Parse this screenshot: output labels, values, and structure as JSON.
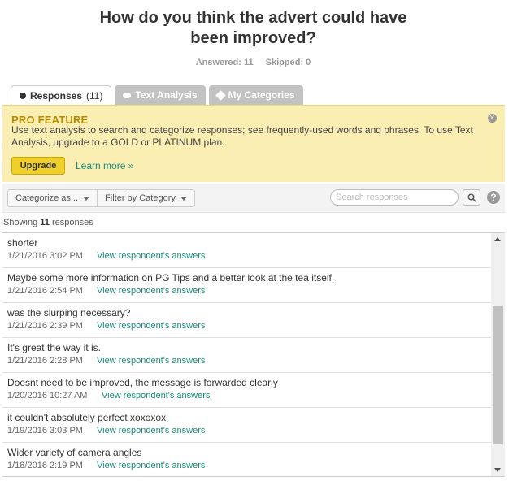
{
  "question": {
    "title_line1": "How do you think the advert could have",
    "title_line2": "been improved?",
    "answered": "Answered: 11",
    "skipped": "Skipped: 0"
  },
  "tabs": [
    {
      "label": "Responses",
      "count": "(11)",
      "icon": "dot-icon",
      "active": true
    },
    {
      "label": "Text Analysis",
      "icon": "cloud-icon",
      "active": false
    },
    {
      "label": "My Categories",
      "icon": "tag-icon",
      "active": false
    }
  ],
  "pro_banner": {
    "title": "PRO FEATURE",
    "text": "Use text analysis to search and categorize responses; see frequently-used words and phrases. To use Text Analysis, upgrade to a GOLD or PLATINUM plan.",
    "upgrade_label": "Upgrade",
    "learn_more_label": "Learn more »",
    "close_icon": "close-icon",
    "background": "#fbeeb2"
  },
  "filter_bar": {
    "categorize_label": "Categorize as...",
    "filter_label": "Filter by Category",
    "search_placeholder": "Search responses",
    "help_glyph": "?"
  },
  "showing": {
    "prefix": "Showing",
    "count": "11",
    "suffix": "responses"
  },
  "responses": [
    {
      "text": "shorter",
      "date": "1/21/2016 3:02 PM",
      "link": "View respondent's answers"
    },
    {
      "text": "Maybe some more information on PG Tips and a better look at the tea itself.",
      "date": "1/21/2016 2:54 PM",
      "link": "View respondent's answers"
    },
    {
      "text": "was the slurping necessary?",
      "date": "1/21/2016 2:39 PM",
      "link": "View respondent's answers"
    },
    {
      "text": "It's great the way it is.",
      "date": "1/21/2016 2:28 PM",
      "link": "View respondent's answers"
    },
    {
      "text": "Doesnt need to be improved, the message is forwarded clearly",
      "date": "1/20/2016 10:27 AM",
      "link": "View respondent's answers"
    },
    {
      "text": "it couldn't absolutely perfect xoxoxox",
      "date": "1/19/2016 3:03 PM",
      "link": "View respondent's answers"
    },
    {
      "text": "Wider variety of camera angles",
      "date": "1/18/2016 2:19 PM",
      "link": "View respondent's answers"
    }
  ],
  "colors": {
    "link": "#1a8a7a",
    "accent": "#f0cf2a",
    "pro_title": "#b88a00"
  }
}
